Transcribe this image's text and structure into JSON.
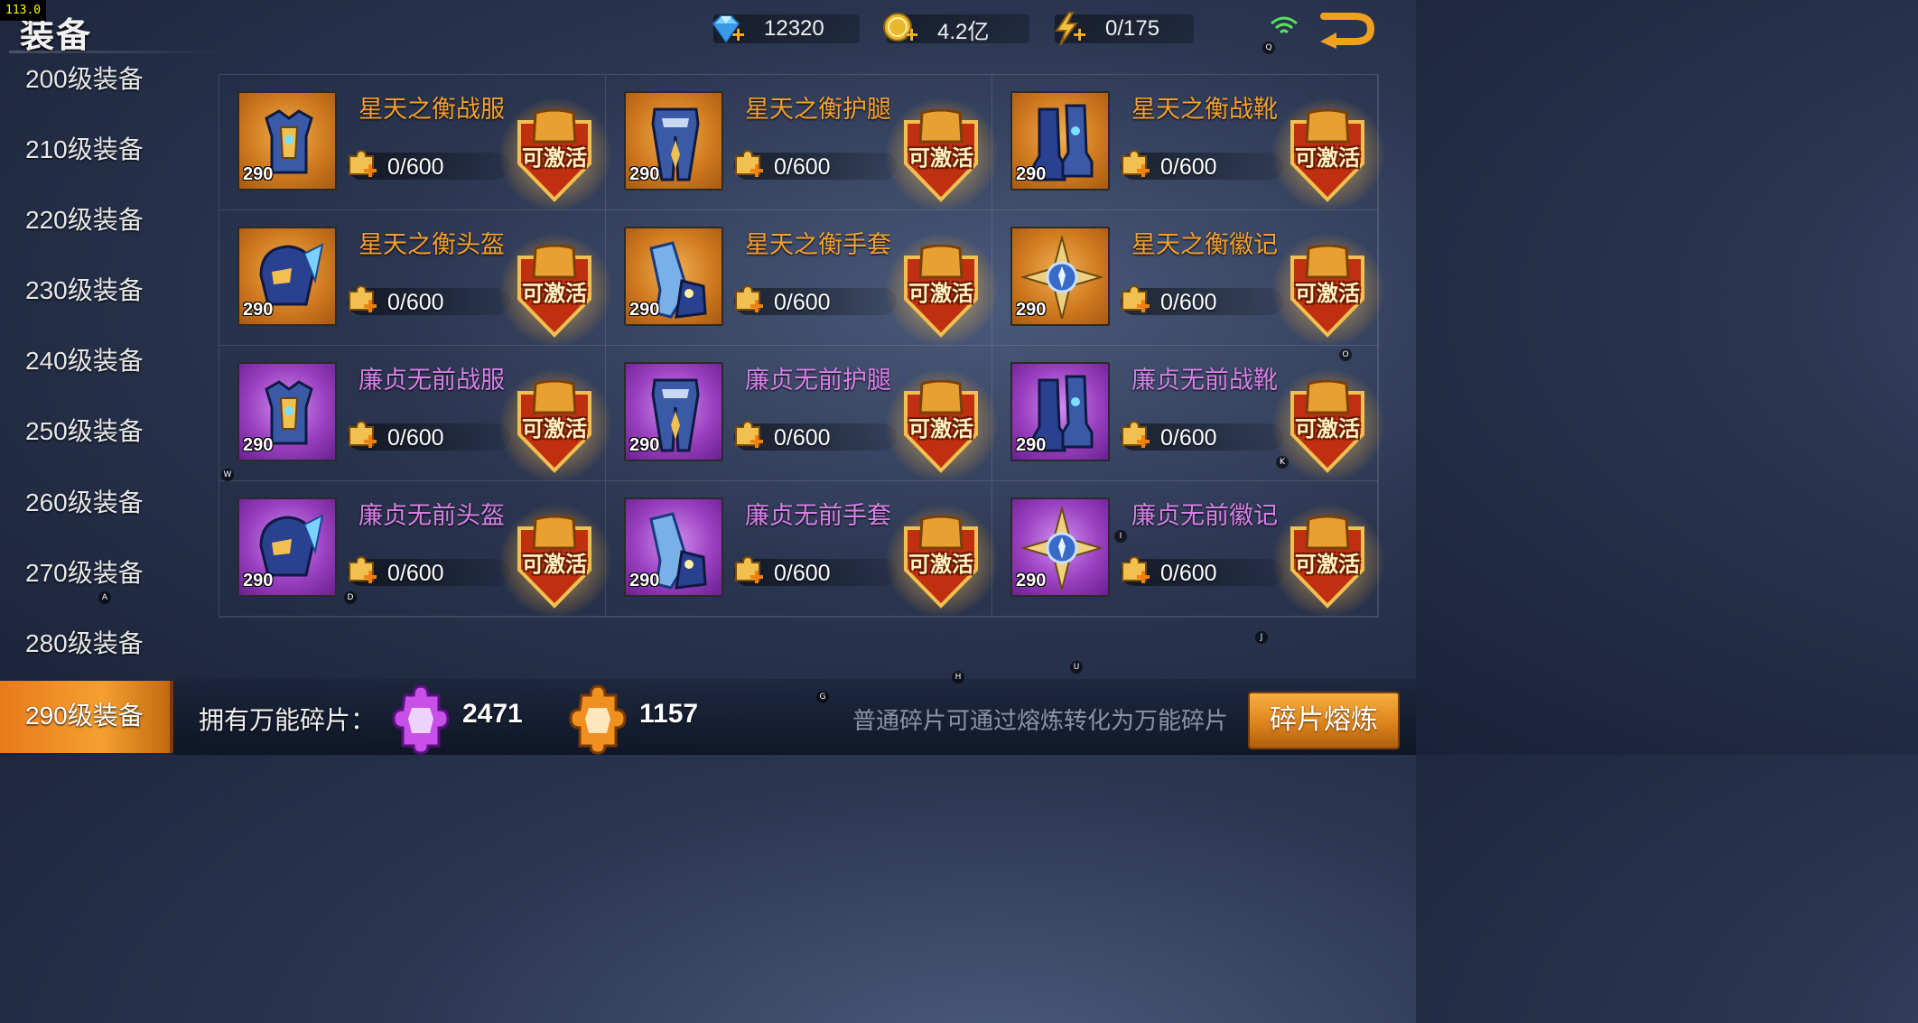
{
  "fps": "113.0",
  "header": {
    "title": "装备",
    "gems": "12320",
    "gold": "4.2亿",
    "energy": "0/175"
  },
  "sidebar": {
    "items": [
      {
        "label": "200级装备"
      },
      {
        "label": "210级装备"
      },
      {
        "label": "220级装备"
      },
      {
        "label": "230级装备"
      },
      {
        "label": "240级装备"
      },
      {
        "label": "250级装备"
      },
      {
        "label": "260级装备"
      },
      {
        "label": "270级装备"
      },
      {
        "label": "280级装备"
      },
      {
        "label": "290级装备",
        "active": true
      }
    ]
  },
  "equipment": [
    {
      "name": "星天之衡战服",
      "level": "290",
      "progress": "0/600",
      "action": "可激活",
      "rarity": "orange",
      "icon": "armor-icon"
    },
    {
      "name": "星天之衡护腿",
      "level": "290",
      "progress": "0/600",
      "action": "可激活",
      "rarity": "orange",
      "icon": "leggings-icon"
    },
    {
      "name": "星天之衡战靴",
      "level": "290",
      "progress": "0/600",
      "action": "可激活",
      "rarity": "orange",
      "icon": "boots-icon"
    },
    {
      "name": "星天之衡头盔",
      "level": "290",
      "progress": "0/600",
      "action": "可激活",
      "rarity": "orange",
      "icon": "helmet-icon"
    },
    {
      "name": "星天之衡手套",
      "level": "290",
      "progress": "0/600",
      "action": "可激活",
      "rarity": "orange",
      "icon": "gloves-icon"
    },
    {
      "name": "星天之衡徽记",
      "level": "290",
      "progress": "0/600",
      "action": "可激活",
      "rarity": "orange",
      "icon": "emblem-icon"
    },
    {
      "name": "廉贞无前战服",
      "level": "290",
      "progress": "0/600",
      "action": "可激活",
      "rarity": "purple",
      "icon": "armor-icon"
    },
    {
      "name": "廉贞无前护腿",
      "level": "290",
      "progress": "0/600",
      "action": "可激活",
      "rarity": "purple",
      "icon": "leggings-icon"
    },
    {
      "name": "廉贞无前战靴",
      "level": "290",
      "progress": "0/600",
      "action": "可激活",
      "rarity": "purple",
      "icon": "boots-icon"
    },
    {
      "name": "廉贞无前头盔",
      "level": "290",
      "progress": "0/600",
      "action": "可激活",
      "rarity": "purple",
      "icon": "helmet-icon"
    },
    {
      "name": "廉贞无前手套",
      "level": "290",
      "progress": "0/600",
      "action": "可激活",
      "rarity": "purple",
      "icon": "gloves-icon"
    },
    {
      "name": "廉贞无前徽记",
      "level": "290",
      "progress": "0/600",
      "action": "可激活",
      "rarity": "purple",
      "icon": "emblem-icon"
    }
  ],
  "footer": {
    "own_label": "拥有万能碎片：",
    "purple_count": "2471",
    "orange_count": "1157",
    "tip": "普通碎片可通过熔炼转化为万能碎片",
    "smelt_label": "碎片熔炼"
  },
  "hints": [
    "Q",
    "O",
    "W",
    "K",
    "I",
    "A",
    "D",
    "J",
    "H",
    "U",
    "G"
  ],
  "colors": {
    "orange_rarity": "#f5a030",
    "purple_rarity": "#d880e8",
    "active_tab": "#f5a030"
  }
}
